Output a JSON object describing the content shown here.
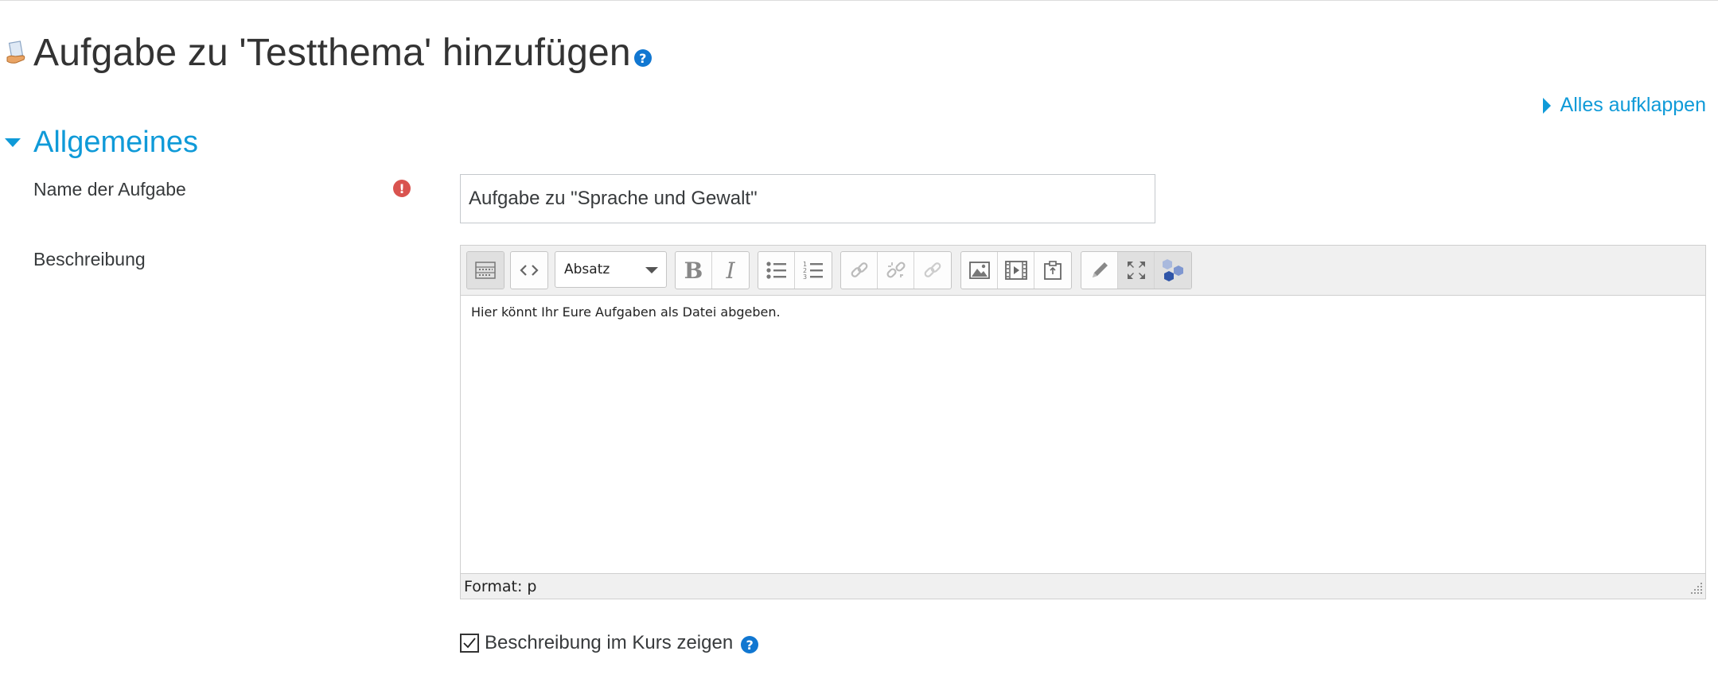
{
  "page": {
    "title": "Aufgabe zu 'Testthema' hinzufügen",
    "icon": "assignment-icon",
    "help_icon": "help-icon"
  },
  "expand_all": {
    "label": "Alles aufklappen"
  },
  "section": {
    "title": "Allgemeines"
  },
  "form": {
    "name": {
      "label": "Name der Aufgabe",
      "value": "Aufgabe zu \"Sprache und Gewalt\"",
      "required_icon": "required-icon"
    },
    "description": {
      "label": "Beschreibung",
      "content": "Hier könnt Ihr Eure Aufgaben als Datei abgeben.",
      "format_status": "Format: p"
    },
    "show_description": {
      "label": "Beschreibung im Kurs zeigen",
      "checked": true
    }
  },
  "editor_toolbar": {
    "paragraph_select": "Absatz",
    "buttons": [
      "toolbar-toggle-icon",
      "html-source-icon",
      "bold-icon",
      "italic-icon",
      "unordered-list-icon",
      "ordered-list-icon",
      "link-icon",
      "unlink-icon",
      "anchor-icon",
      "image-icon",
      "media-icon",
      "manage-files-icon",
      "pencil-icon",
      "fullscreen-icon",
      "h5p-icon"
    ]
  },
  "colors": {
    "accent": "#0f9ad8",
    "required": "#d9534f",
    "help": "#1177d1",
    "text": "#373a3c"
  }
}
